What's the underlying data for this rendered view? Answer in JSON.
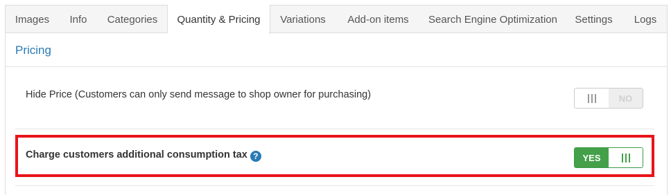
{
  "tabs": [
    {
      "label": "Images"
    },
    {
      "label": "Info"
    },
    {
      "label": "Categories"
    },
    {
      "label": "Quantity & Pricing",
      "active": true
    },
    {
      "label": "Variations"
    },
    {
      "label": "Add-on items"
    },
    {
      "label": "Search Engine Optimization"
    },
    {
      "label": "Settings"
    },
    {
      "label": "Logs"
    }
  ],
  "section": {
    "title": "Pricing"
  },
  "rows": {
    "hide_price": {
      "label": "Hide Price (Customers can only send message to shop owner for purchasing)",
      "toggle_label": "NO",
      "value": "off"
    },
    "consumption_tax": {
      "label": "Charge customers additional consumption tax",
      "help_icon": "?",
      "toggle_label": "YES",
      "value": "on"
    }
  },
  "colors": {
    "accent": "#2a7ab5",
    "toggle_on": "#44a049",
    "highlight": "#e8141a"
  }
}
